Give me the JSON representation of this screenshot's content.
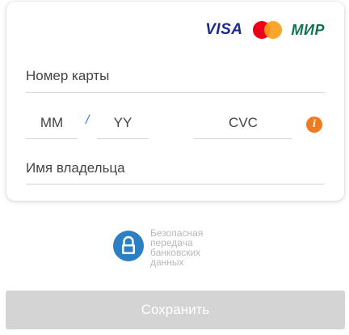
{
  "card_form": {
    "logos": {
      "visa": "VISA",
      "mastercard": "mastercard-logo",
      "mir": "МИР"
    },
    "card_number": {
      "placeholder": "Номер карты"
    },
    "expiry_month": {
      "placeholder": "MM"
    },
    "expiry_separator": "/",
    "expiry_year": {
      "placeholder": "YY"
    },
    "cvc": {
      "placeholder": "CVC"
    },
    "cvc_info_icon": "i",
    "cardholder": {
      "placeholder": "Имя владельца"
    }
  },
  "security_note": {
    "icon": "lock-icon",
    "text": "Безопасная передача банковских данных"
  },
  "actions": {
    "save_label": "Сохранить"
  },
  "colors": {
    "visa": "#1a2b8c",
    "mastercard_red": "#eb001b",
    "mastercard_orange": "#f79e1b",
    "mir": "#0f754e",
    "info_icon": "#f07a22",
    "lock_icon": "#2b80c4",
    "save_button_disabled": "#d4d4d4",
    "separator": "#2f7fd0"
  }
}
